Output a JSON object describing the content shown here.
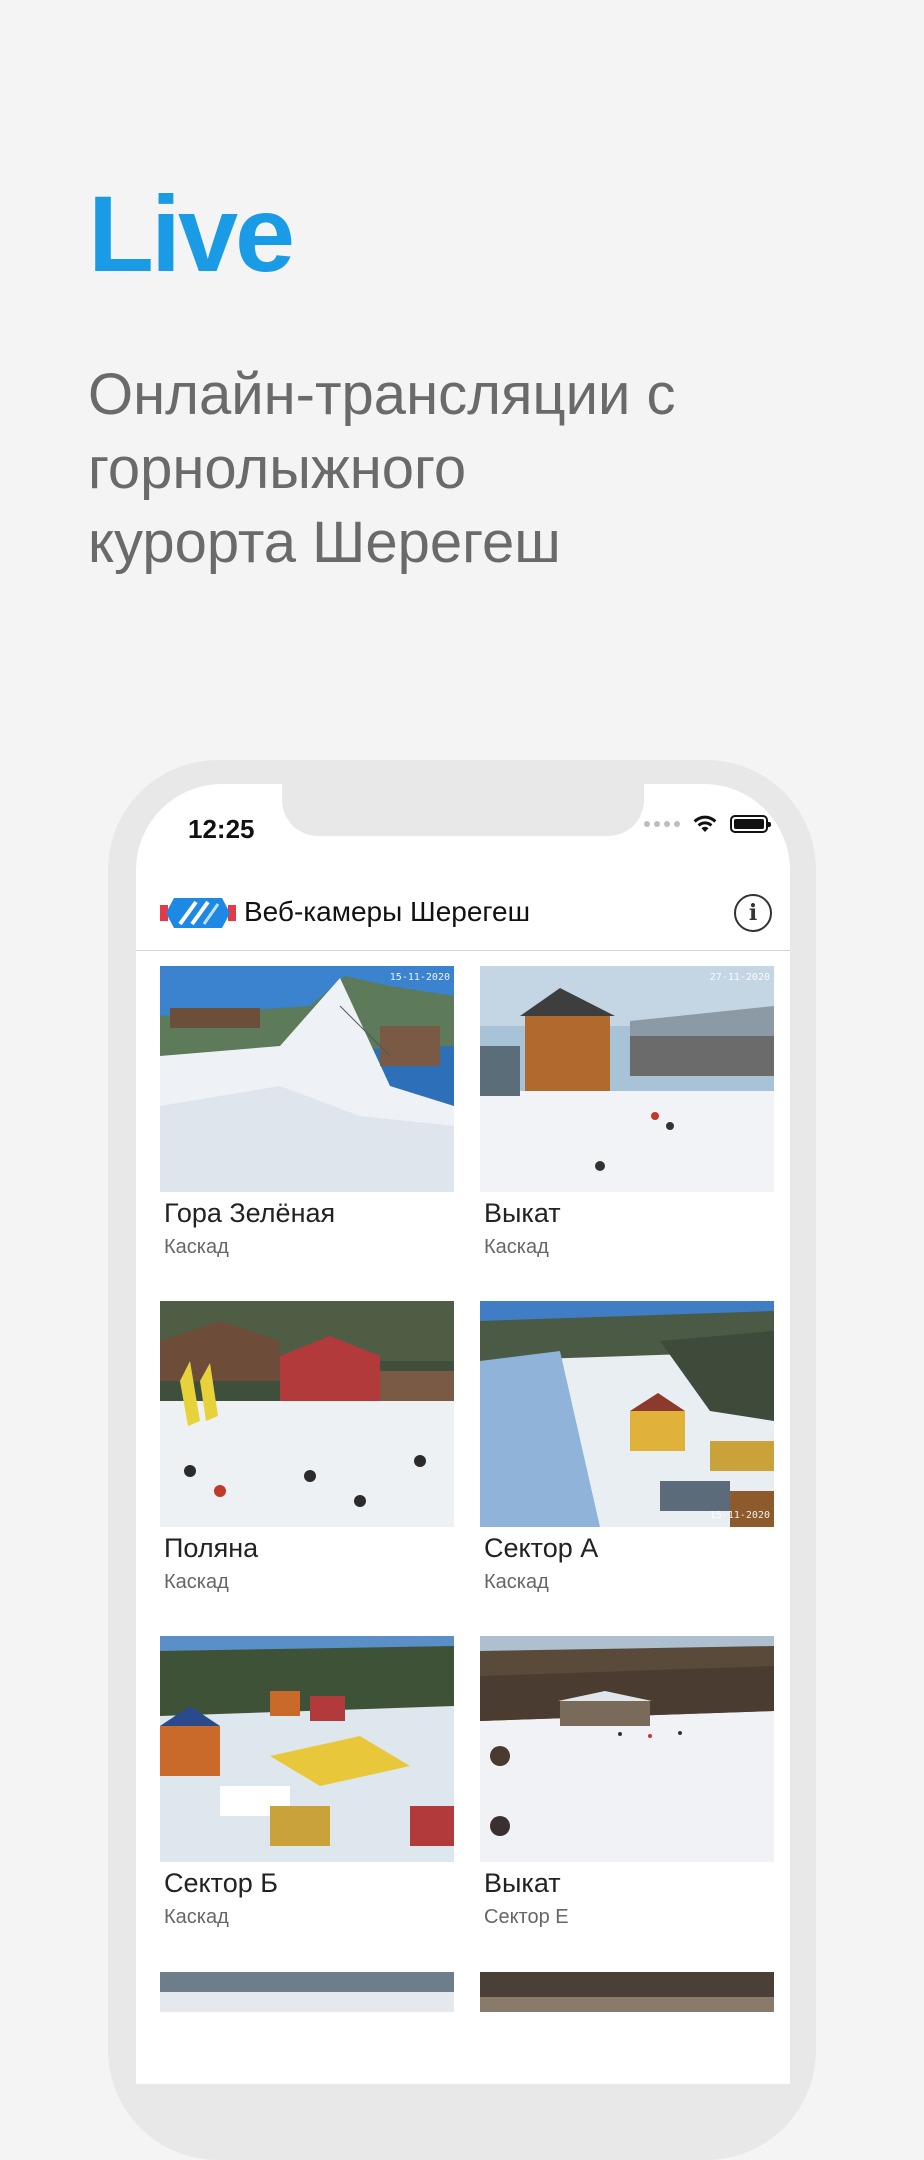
{
  "hero": {
    "title": "Live",
    "subtitle_lines": [
      "Онлайн-трансляции с",
      "горнолыжного",
      "курорта Шерегеш"
    ]
  },
  "status_bar": {
    "time": "12:25"
  },
  "app": {
    "title": "Веб-камеры Шерегеш",
    "logo_icon": "sheregesh-logo-icon",
    "info_icon": "info-icon"
  },
  "cameras": [
    {
      "name": "Гора Зелёная",
      "group": "Каскад",
      "stamp": "15-11-2020"
    },
    {
      "name": "Выкат",
      "group": "Каскад",
      "stamp": "27-11-2020"
    },
    {
      "name": "Поляна",
      "group": "Каскад",
      "stamp": ""
    },
    {
      "name": "Сектор А",
      "group": "Каскад",
      "stamp": "15-11-2020"
    },
    {
      "name": "Сектор Б",
      "group": "Каскад",
      "stamp": ""
    },
    {
      "name": "Выкат",
      "group": "Сектор Е",
      "stamp": ""
    }
  ],
  "colors": {
    "accent": "#1a9be6",
    "subtitle": "#6a6a6a",
    "background": "#f4f4f4",
    "logo_red": "#e63946",
    "logo_blue": "#1e88e5"
  }
}
